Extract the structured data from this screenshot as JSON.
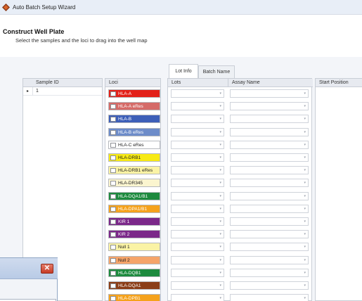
{
  "window": {
    "title": "Auto Batch Setup Wizard"
  },
  "header": {
    "title": "Construct Well Plate",
    "subtitle": "Select the samples and the loci to drag into the well map"
  },
  "samples": {
    "column_header": "Sample ID",
    "rows": [
      {
        "id": "1",
        "selected_marker": "▸"
      }
    ]
  },
  "loci": {
    "column_header": "Loci",
    "items": [
      {
        "label": "HLA-A",
        "color": "#e32119",
        "text_color": "#ffffff"
      },
      {
        "label": "HLA-A eRes",
        "color": "#d56b68",
        "text_color": "#ffffff"
      },
      {
        "label": "HLA-B",
        "color": "#3d5fb8",
        "text_color": "#ffffff"
      },
      {
        "label": "HLA-B eRes",
        "color": "#6d8cc9",
        "text_color": "#ffffff"
      },
      {
        "label": "HLA-C eRes",
        "color": "#ffffff",
        "text_color": "#222222"
      },
      {
        "label": "HLA-DRB1",
        "color": "#f7ea14",
        "text_color": "#222222"
      },
      {
        "label": "HLA-DRB1 eRes",
        "color": "#faf3a5",
        "text_color": "#222222"
      },
      {
        "label": "HLA-DR345",
        "color": "#fbf5cf",
        "text_color": "#222222"
      },
      {
        "label": "HLA-DQA1/B1",
        "color": "#1d8a3e",
        "text_color": "#ffffff"
      },
      {
        "label": "HLA-DPA1/B1",
        "color": "#f5a21c",
        "text_color": "#ffffff"
      },
      {
        "label": "KIR 1",
        "color": "#7b2889",
        "text_color": "#ffffff"
      },
      {
        "label": "KIR 2",
        "color": "#7b2889",
        "text_color": "#ffffff"
      },
      {
        "label": "Null 1",
        "color": "#faf3a5",
        "text_color": "#222222"
      },
      {
        "label": "Null 2",
        "color": "#f5a46a",
        "text_color": "#222222"
      },
      {
        "label": "HLA-DQB1",
        "color": "#1d8a3e",
        "text_color": "#ffffff"
      },
      {
        "label": "HLA-DQA1",
        "color": "#8b3e18",
        "text_color": "#ffffff"
      },
      {
        "label": "HLA-DPB1",
        "color": "#f5a21c",
        "text_color": "#ffffff"
      }
    ]
  },
  "tabs": [
    {
      "label": "Lot Info",
      "active": true
    },
    {
      "label": "Batch Name",
      "active": false
    }
  ],
  "lots_grid": {
    "headers": {
      "lots": "Lots",
      "assay": "Assay Name"
    }
  },
  "start_position": {
    "column_header": "Start Position"
  },
  "dialog": {
    "close_glyph": "✕"
  },
  "icons": {
    "app": "app-diamond-icon",
    "dropdown": "chevron-down-icon"
  }
}
